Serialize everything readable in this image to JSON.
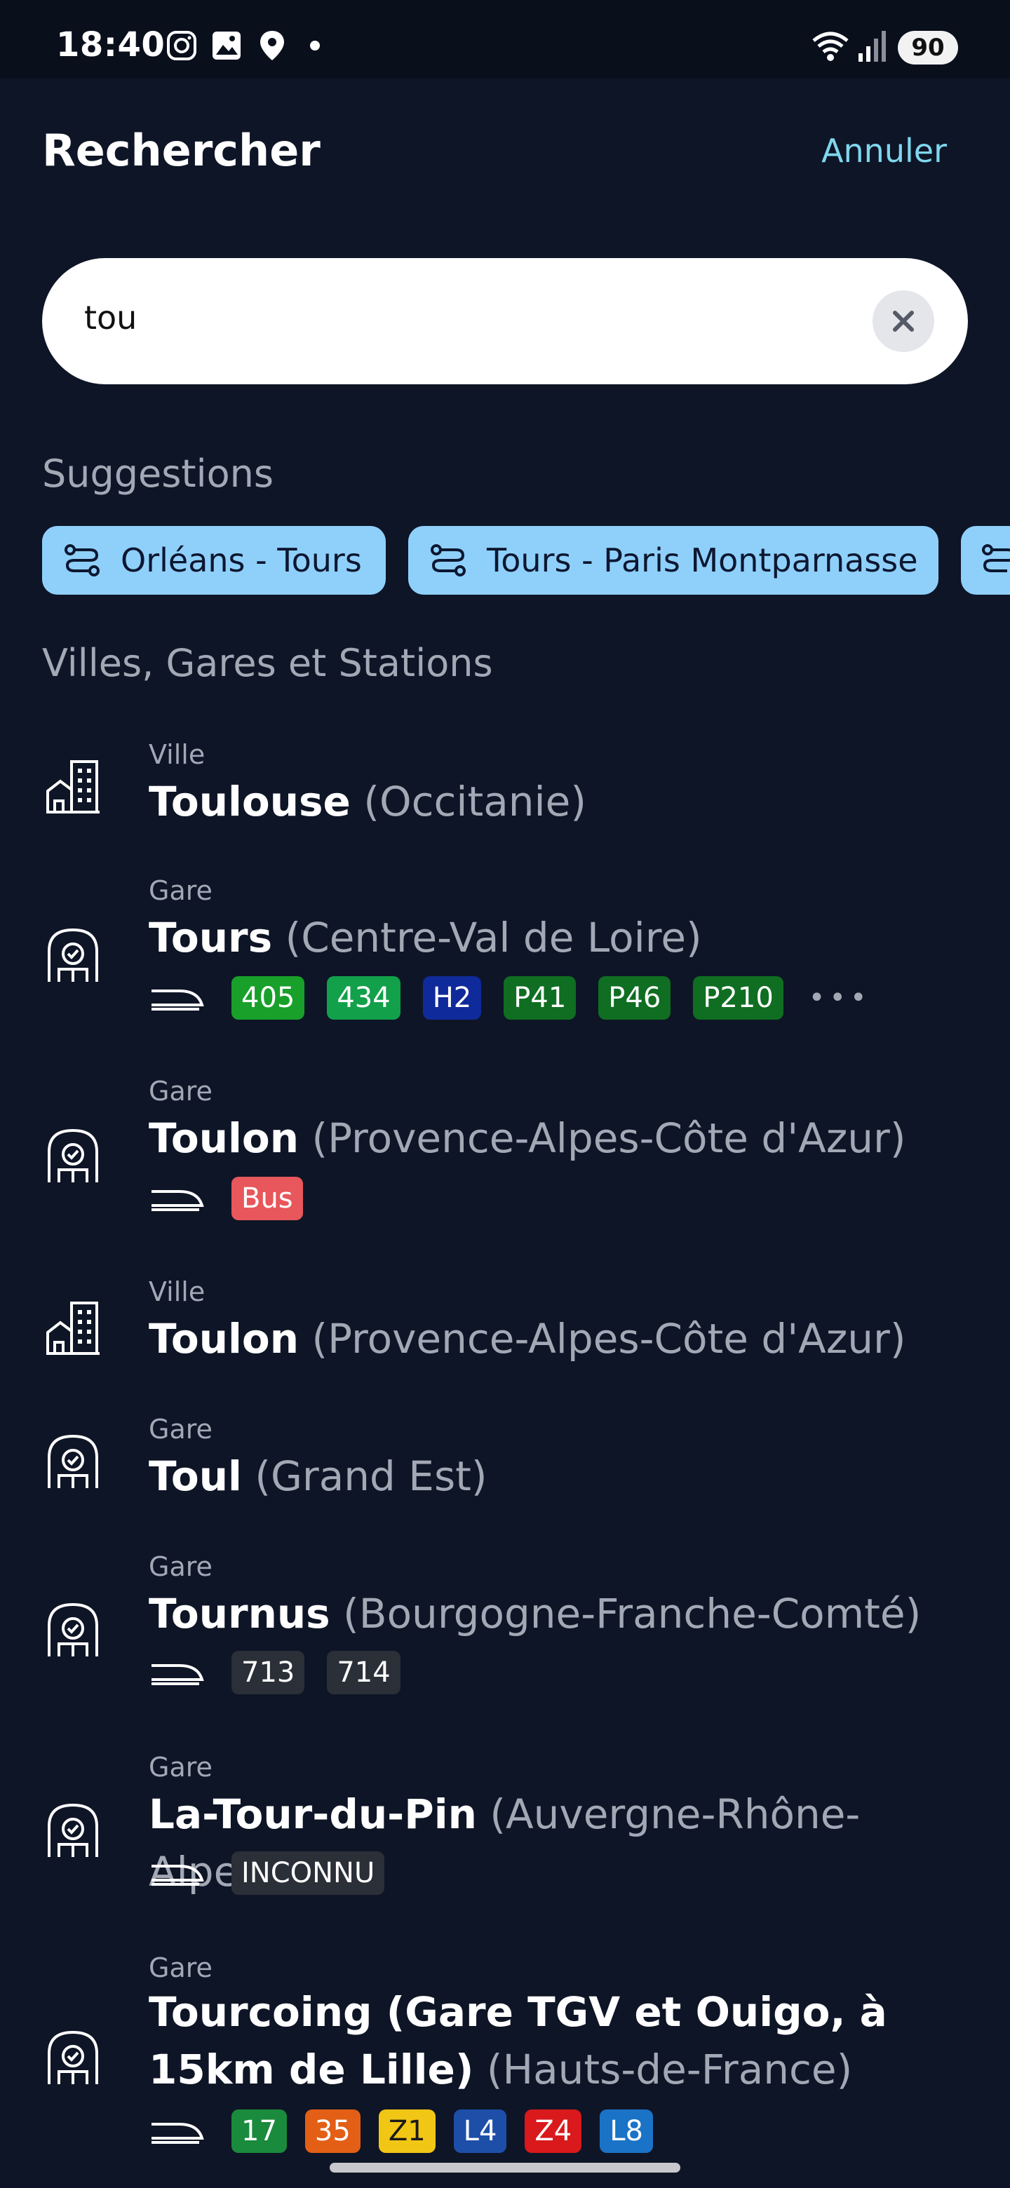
{
  "status_bar": {
    "time": "18:40",
    "battery": "90"
  },
  "header": {
    "title": "Rechercher",
    "cancel_label": "Annuler"
  },
  "search": {
    "value": "tou",
    "placeholder": ""
  },
  "suggestions": {
    "title": "Suggestions",
    "chips": [
      {
        "label": "Orléans - Tours",
        "icon": "route-icon"
      },
      {
        "label": "Tours - Paris Montparnasse",
        "icon": "route-icon"
      }
    ]
  },
  "places": {
    "title": "Villes, Gares et Stations",
    "items": [
      {
        "kind": "Ville",
        "name": "Toulouse",
        "region": "(Occitanie)",
        "icon": "city-icon",
        "lines": []
      },
      {
        "kind": "Gare",
        "name": "Tours",
        "region": "(Centre-Val de Loire)",
        "icon": "station-icon",
        "lines": [
          {
            "label": "405",
            "color": "#18a02a"
          },
          {
            "label": "434",
            "color": "#12a04a"
          },
          {
            "label": "H2",
            "color": "#0f2a9a"
          },
          {
            "label": "P41",
            "color": "#0f6e21"
          },
          {
            "label": "P46",
            "color": "#0f6e21"
          },
          {
            "label": "P210",
            "color": "#0f6e21"
          }
        ],
        "more": "•••"
      },
      {
        "kind": "Gare",
        "name": "Toulon",
        "region": "(Provence-Alpes-Côte d'Azur)",
        "icon": "station-icon",
        "lines": [
          {
            "label": "Bus",
            "color": "#e8575b"
          }
        ]
      },
      {
        "kind": "Ville",
        "name": "Toulon",
        "region": "(Provence-Alpes-Côte d'Azur)",
        "icon": "city-icon",
        "lines": []
      },
      {
        "kind": "Gare",
        "name": "Toul",
        "region": "(Grand Est)",
        "icon": "station-icon",
        "lines": []
      },
      {
        "kind": "Gare",
        "name": "Tournus",
        "region": "(Bourgogne-Franche-Comté)",
        "icon": "station-icon",
        "lines": [
          {
            "label": "713",
            "color": "#2b2f38"
          },
          {
            "label": "714",
            "color": "#2b2f38"
          }
        ]
      },
      {
        "kind": "Gare",
        "name": "La-Tour-du-Pin",
        "region": "(Auvergne-Rhône-Alpes)",
        "icon": "station-icon",
        "lines": [
          {
            "label": "INCONNU",
            "color": "#2b2f38"
          }
        ]
      },
      {
        "kind": "Gare",
        "name": "Tourcoing (Gare TGV et Ouigo, à 15km de Lille)",
        "region": "(Hauts-de-France)",
        "icon": "station-icon",
        "lines": [
          {
            "label": "17",
            "color": "#1a8a3c"
          },
          {
            "label": "35",
            "color": "#e35f16"
          },
          {
            "label": "Z1",
            "color": "#f2c614"
          },
          {
            "label": "L4",
            "color": "#1d4fa8"
          },
          {
            "label": "Z4",
            "color": "#d9191c"
          },
          {
            "label": "L8",
            "color": "#1a73c6"
          }
        ]
      }
    ]
  }
}
